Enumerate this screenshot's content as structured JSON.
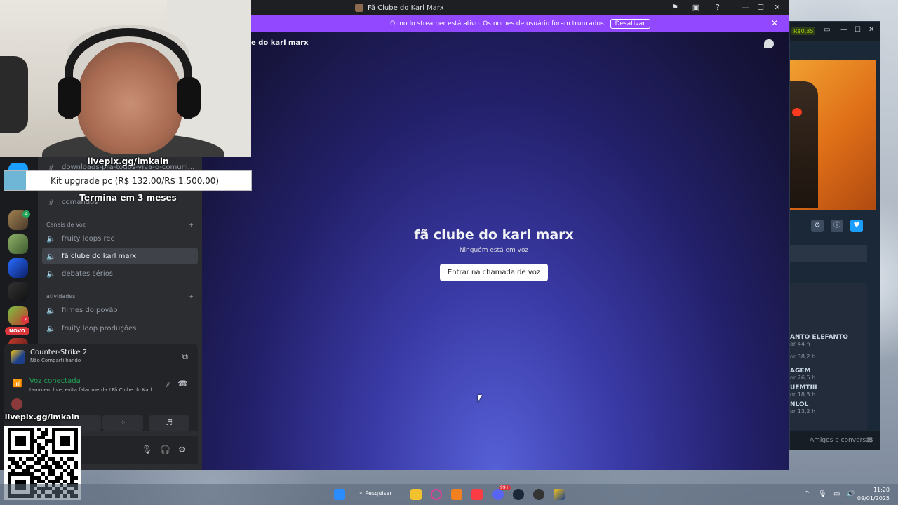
{
  "window": {
    "title": "Fã Clube do Karl Marx"
  },
  "banner": {
    "text": "O modo streamer está ativo. Os nomes de usuário foram truncados.",
    "button": "Desativar"
  },
  "header": {
    "channel": "e do karl marx"
  },
  "channels": {
    "text_items": [
      "downloads-pra-todos-viva-o-comuni...",
      "comandos"
    ],
    "voice_category": "Canais de Voz",
    "voice_items": [
      "fruity loops rec",
      "fã clube do karl marx",
      "debates sérios"
    ],
    "activity_category": "atividades",
    "activity_items": [
      "filmes do povão",
      "fruity loop produções"
    ]
  },
  "activity": {
    "game": "Counter-Strike 2",
    "status": "Não Compartilhando"
  },
  "voice": {
    "status": "Voz conectada",
    "detail": "tamo em live, evita falar merda / Fã Clube do Karl..."
  },
  "main": {
    "title": "fã clube do karl marx",
    "subtitle": "Ninguém está em voz",
    "join_button": "Entrar na chamada de voz"
  },
  "overlay": {
    "livepix": "livepix.gg/imkain",
    "goal_label": "Kit upgrade pc (R$ 132,00/R$ 1.500,00)",
    "goal_progress": 0.088,
    "goal_ends": "Termina em 3 meses",
    "badge_new": "NOVO",
    "server_badge_1": "4",
    "server_badge_2": "2"
  },
  "steam": {
    "balance": "R$0,35",
    "friends": [
      {
        "name": "ANTO ELEFANTO",
        "hours": "or 44 h"
      },
      {
        "name": "",
        "hours": "or 38,2 h"
      },
      {
        "name": "AGEM",
        "hours": "or 26,5 h"
      },
      {
        "name": "UEMTIII",
        "hours": "or 18,3 h"
      },
      {
        "name": "NLOL",
        "hours": "or 13,2 h"
      }
    ],
    "footer": "Amigos e conversas"
  },
  "taskbar": {
    "search": "Pesquisar",
    "time": "11:20",
    "date": "09/01/2025",
    "discord_badge": "99+"
  },
  "colors": {
    "accent_purple": "#9148ff",
    "voice_green": "#23a55a",
    "steam_blue": "#1a9fff"
  }
}
